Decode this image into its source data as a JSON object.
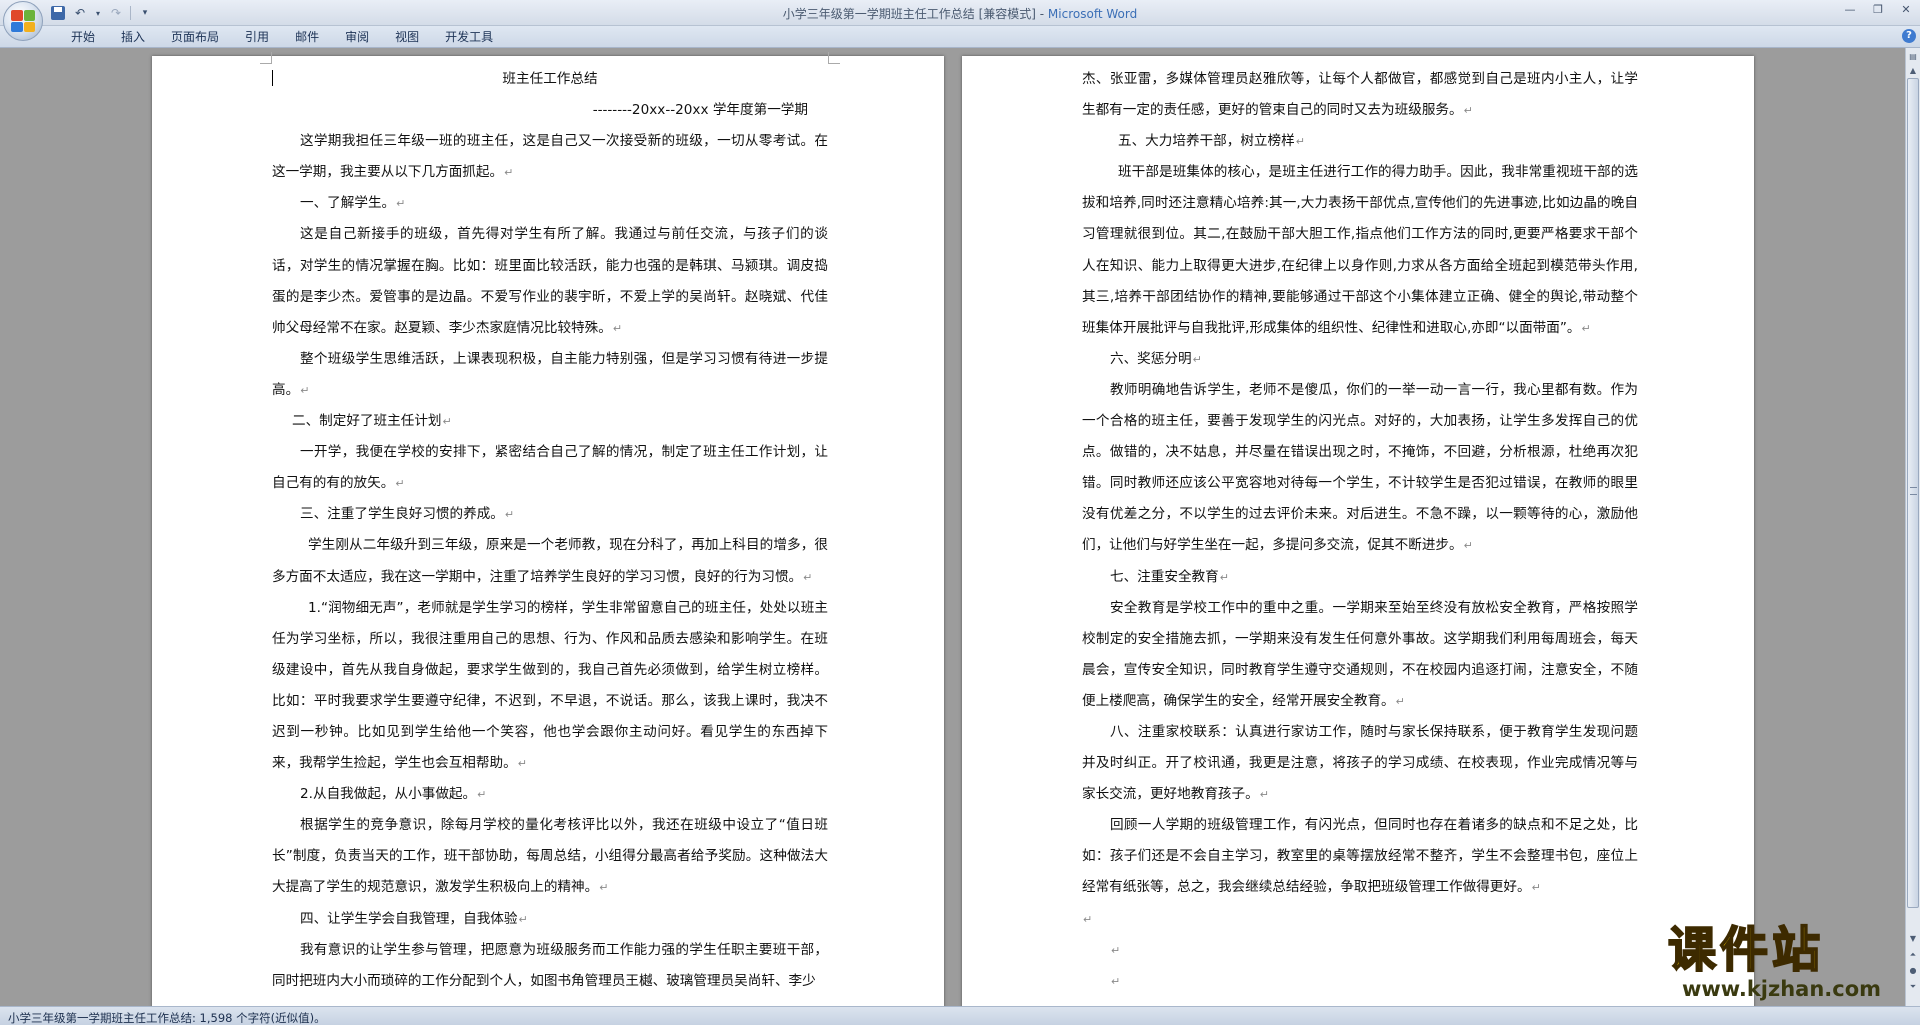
{
  "window": {
    "title_doc": "小学三年级第一学期班主任工作总结 [兼容模式] - ",
    "title_app": "Microsoft Word"
  },
  "qat": {
    "save_icon": "save-icon",
    "undo_icon": "undo-icon",
    "redo_icon": "redo-icon",
    "customize_icon": "dropdown-icon"
  },
  "tabs": [
    "开始",
    "插入",
    "页面布局",
    "引用",
    "邮件",
    "审阅",
    "视图",
    "开发工具"
  ],
  "status": {
    "text": "小学三年级第一学期班主任工作总结: 1,598 个字符(近似值)。"
  },
  "watermark": {
    "name": "课件站",
    "url": "www.kjzhan.com"
  },
  "pages": {
    "left": [
      {
        "t": "班主任工作总结",
        "s": "center"
      },
      {
        "t": "--------20xx--20xx 学年度第一学期",
        "s": "right"
      },
      {
        "t": "这学期我担任三年级一班的班主任，这是自己又一次接受新的班级，一切从零考试。在这一学期，我主要从以下几方面抓起。",
        "s": "ind2",
        "m": "↵"
      },
      {
        "t": "一、了解学生。",
        "s": "ind2",
        "m": "↵"
      },
      {
        "t": "这是自己新接手的班级，首先得对学生有所了解。我通过与前任交流，与孩子们的谈话，对学生的情况掌握在胸。比如：班里面比较活跃，能力也强的是韩琪、马颍琪。调皮捣蛋的是李少杰。爱管事的是边晶。不爱写作业的裴宇昕，不爱上学的吴尚轩。赵晓斌、代佳帅父母经常不在家。赵夏颖、李少杰家庭情况比较特殊。",
        "s": "ind2",
        "m": "↵"
      },
      {
        "t": "整个班级学生思维活跃，上课表现积极，自主能力特别强，但是学习习惯有待进一步提高。",
        "s": "ind2",
        "m": "↵"
      },
      {
        "t": "二、制定好了班主任计划",
        "s": "ind1",
        "m": "↵"
      },
      {
        "t": "一开学，我便在学校的安排下，紧密结合自己了解的情况，制定了班主任工作计划，让自己有的有的放矢。",
        "s": "ind2",
        "m": "↵"
      },
      {
        "t": "三、注重了学生良好习惯的养成。",
        "s": "ind2",
        "m": "↵"
      },
      {
        "t": "学生刚从二年级升到三年级，原来是一个老师教，现在分科了，再加上科目的增多，很多方面不太适应，我在这一学期中，注重了培养学生良好的学习习惯，良好的行为习惯。",
        "s": "ind3",
        "m": "↵"
      },
      {
        "t": "1.“润物细无声”，老师就是学生学习的榜样，学生非常留意自己的班主任，处处以班主任为学习坐标，所以，我很注重用自己的思想、行为、作风和品质去感染和影响学生。在班级建设中，首先从我自身做起，要求学生做到的，我自己首先必须做到，给学生树立榜样。比如：平时我要求学生要遵守纪律，不迟到，不早退，不说话。那么，该我上课时，我决不迟到一秒钟。比如见到学生给他一个笑容，他也学会跟你主动问好。看见学生的东西掉下来，我帮学生捡起，学生也会互相帮助。",
        "s": "ind3",
        "m": "↵"
      },
      {
        "t": "2.从自我做起，从小事做起。",
        "s": "ind2",
        "m": "↵"
      },
      {
        "t": "根据学生的竞争意识，除每月学校的量化考核评比以外，我还在班级中设立了“值日班长”制度，负责当天的工作，班干部协助，每周总结，小组得分最高者给予奖励。这种做法大大提高了学生的规范意识，激发学生积极向上的精神。",
        "s": "ind2",
        "m": "↵"
      },
      {
        "t": "四、让学生学会自我管理，自我体验",
        "s": "ind2",
        "m": "↵"
      },
      {
        "t": "我有意识的让学生参与管理，把愿意为班级服务而工作能力强的学生任职主要班干部，同时把班内大小而琐碎的工作分配到个人，如图书角管理员王樾、玻璃管理员吴尚轩、李少",
        "s": "ind2",
        "m": ""
      }
    ],
    "right": [
      {
        "t": "杰、张亚雷，多媒体管理员赵雅欣等，让每个人都做官，都感觉到自己是班内小主人，让学生都有一定的责任感，更好的管束自己的同时又去为班级服务。",
        "s": "",
        "m": "↵"
      },
      {
        "t": "五、大力培养干部，树立榜样",
        "s": "ind3",
        "m": "↵"
      },
      {
        "t": "班干部是班集体的核心，是班主任进行工作的得力助手。因此，我非常重视班干部的选拔和培养,同时还注意精心培养:其一,大力表扬干部优点,宣传他们的先进事迹,比如边晶的晚自习管理就很到位。其二,在鼓励干部大胆工作,指点他们工作方法的同时,更要严格要求干部个人在知识、能力上取得更大进步,在纪律上以身作则,力求从各方面给全班起到模范带头作用,其三,培养干部团结协作的精神,要能够通过干部这个小集体建立正确、健全的舆论,带动整个班集体开展批评与自我批评,形成集体的组织性、纪律性和进取心,亦即“以面带面”。",
        "s": "ind3",
        "m": "↵"
      },
      {
        "t": "六、奖惩分明",
        "s": "ind2",
        "m": "↵"
      },
      {
        "t": "教师明确地告诉学生，老师不是傻瓜，你们的一举一动一言一行，我心里都有数。作为一个合格的班主任，要善于发现学生的闪光点。对好的，大加表扬，让学生多发挥自己的优点。做错的，决不姑息，并尽量在错误出现之时，不掩饰，不回避，分析根源，杜绝再次犯错。同时教师还应该公平宽容地对待每一个学生，不计较学生是否犯过错误，在教师的眼里没有优差之分，不以学生的过去评价未来。对后进生。不急不躁，以一颗等待的心，激励他们，让他们与好学生坐在一起，多提问多交流，促其不断进步。",
        "s": "ind2",
        "m": "↵"
      },
      {
        "t": "七、注重安全教育",
        "s": "ind2",
        "m": "↵"
      },
      {
        "t": "安全教育是学校工作中的重中之重。一学期来至始至终没有放松安全教育，严格按照学校制定的安全措施去抓，一学期来没有发生任何意外事故。这学期我们利用每周班会，每天晨会，宣传安全知识，同时教育学生遵守交通规则，不在校园内追逐打闹，注意安全，不随便上楼爬高，确保学生的安全，经常开展安全教育。",
        "s": "ind2",
        "m": "↵"
      },
      {
        "t": "八、注重家校联系：认真进行家访工作，随时与家长保持联系，便于教育学生发现问题并及时纠正。开了校讯通，我更是注意，将孩子的学习成绩、在校表现，作业完成情况等与家长交流，更好地教育孩子。",
        "s": "ind2",
        "m": "↵"
      },
      {
        "t": "回顾一人学期的班级管理工作，有闪光点，但同时也存在着诸多的缺点和不足之处，比如：孩子们还是不会自主学习，教室里的桌等摆放经常不整齐，学生不会整理书包，座位上经常有纸张等，总之，我会继续总结经验，争取把班级管理工作做得更好。",
        "s": "ind2",
        "m": "↵"
      },
      {
        "t": "",
        "s": "",
        "m": "↵"
      },
      {
        "t": "",
        "s": "ind2",
        "m": "↵"
      },
      {
        "t": "",
        "s": "ind2",
        "m": "↵"
      }
    ]
  },
  "colors": {
    "office_logo": [
      "#e0482a",
      "#6bb33b",
      "#2f7ad9",
      "#f2b01e"
    ]
  }
}
